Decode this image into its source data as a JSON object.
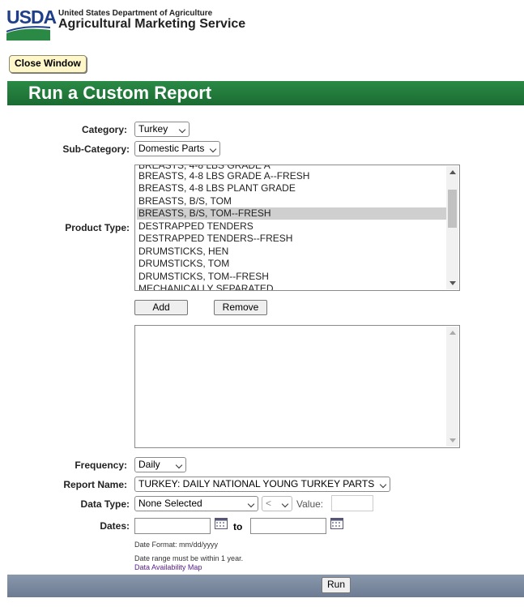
{
  "header": {
    "logo_text": "USDA",
    "department": "United States Department of Agriculture",
    "agency": "Agricultural Marketing Service"
  },
  "close_button": "Close Window",
  "banner_title": "Run a Custom Report",
  "form": {
    "category": {
      "label": "Category:",
      "value": "Turkey"
    },
    "subcategory": {
      "label": "Sub-Category:",
      "value": "Domestic Parts"
    },
    "product_type": {
      "label": "Product Type:",
      "items": [
        "BREASTS, 4-8 LBS GRADE A",
        "BREASTS, 4-8 LBS GRADE A--FRESH",
        "BREASTS, 4-8 LBS PLANT GRADE",
        "BREASTS, B/S, TOM",
        "BREASTS, B/S, TOM--FRESH",
        "DESTRAPPED TENDERS",
        "DESTRAPPED TENDERS--FRESH",
        "DRUMSTICKS, HEN",
        "DRUMSTICKS, TOM",
        "DRUMSTICKS, TOM--FRESH",
        "MECHANICALLY SEPARATED"
      ],
      "selected_index": 4
    },
    "add_label": "Add",
    "remove_label": "Remove",
    "frequency": {
      "label": "Frequency:",
      "value": "Daily"
    },
    "report_name": {
      "label": "Report Name:",
      "value": "TURKEY: DAILY NATIONAL YOUNG TURKEY PARTS"
    },
    "data_type": {
      "label": "Data Type:",
      "value": "None Selected",
      "operator": "<",
      "value_label": "Value:"
    },
    "dates": {
      "label": "Dates:",
      "to_label": "to",
      "format_note": "Date Format: mm/dd/yyyy",
      "range_note": "Date range must be within 1 year.",
      "map_link": "Data Availability Map"
    },
    "run_label": "Run"
  },
  "colors": {
    "banner": "#1f7a3c",
    "footer": "#7a889e",
    "logo_blue": "#1f3f8a",
    "logo_green": "#2a8a45"
  }
}
